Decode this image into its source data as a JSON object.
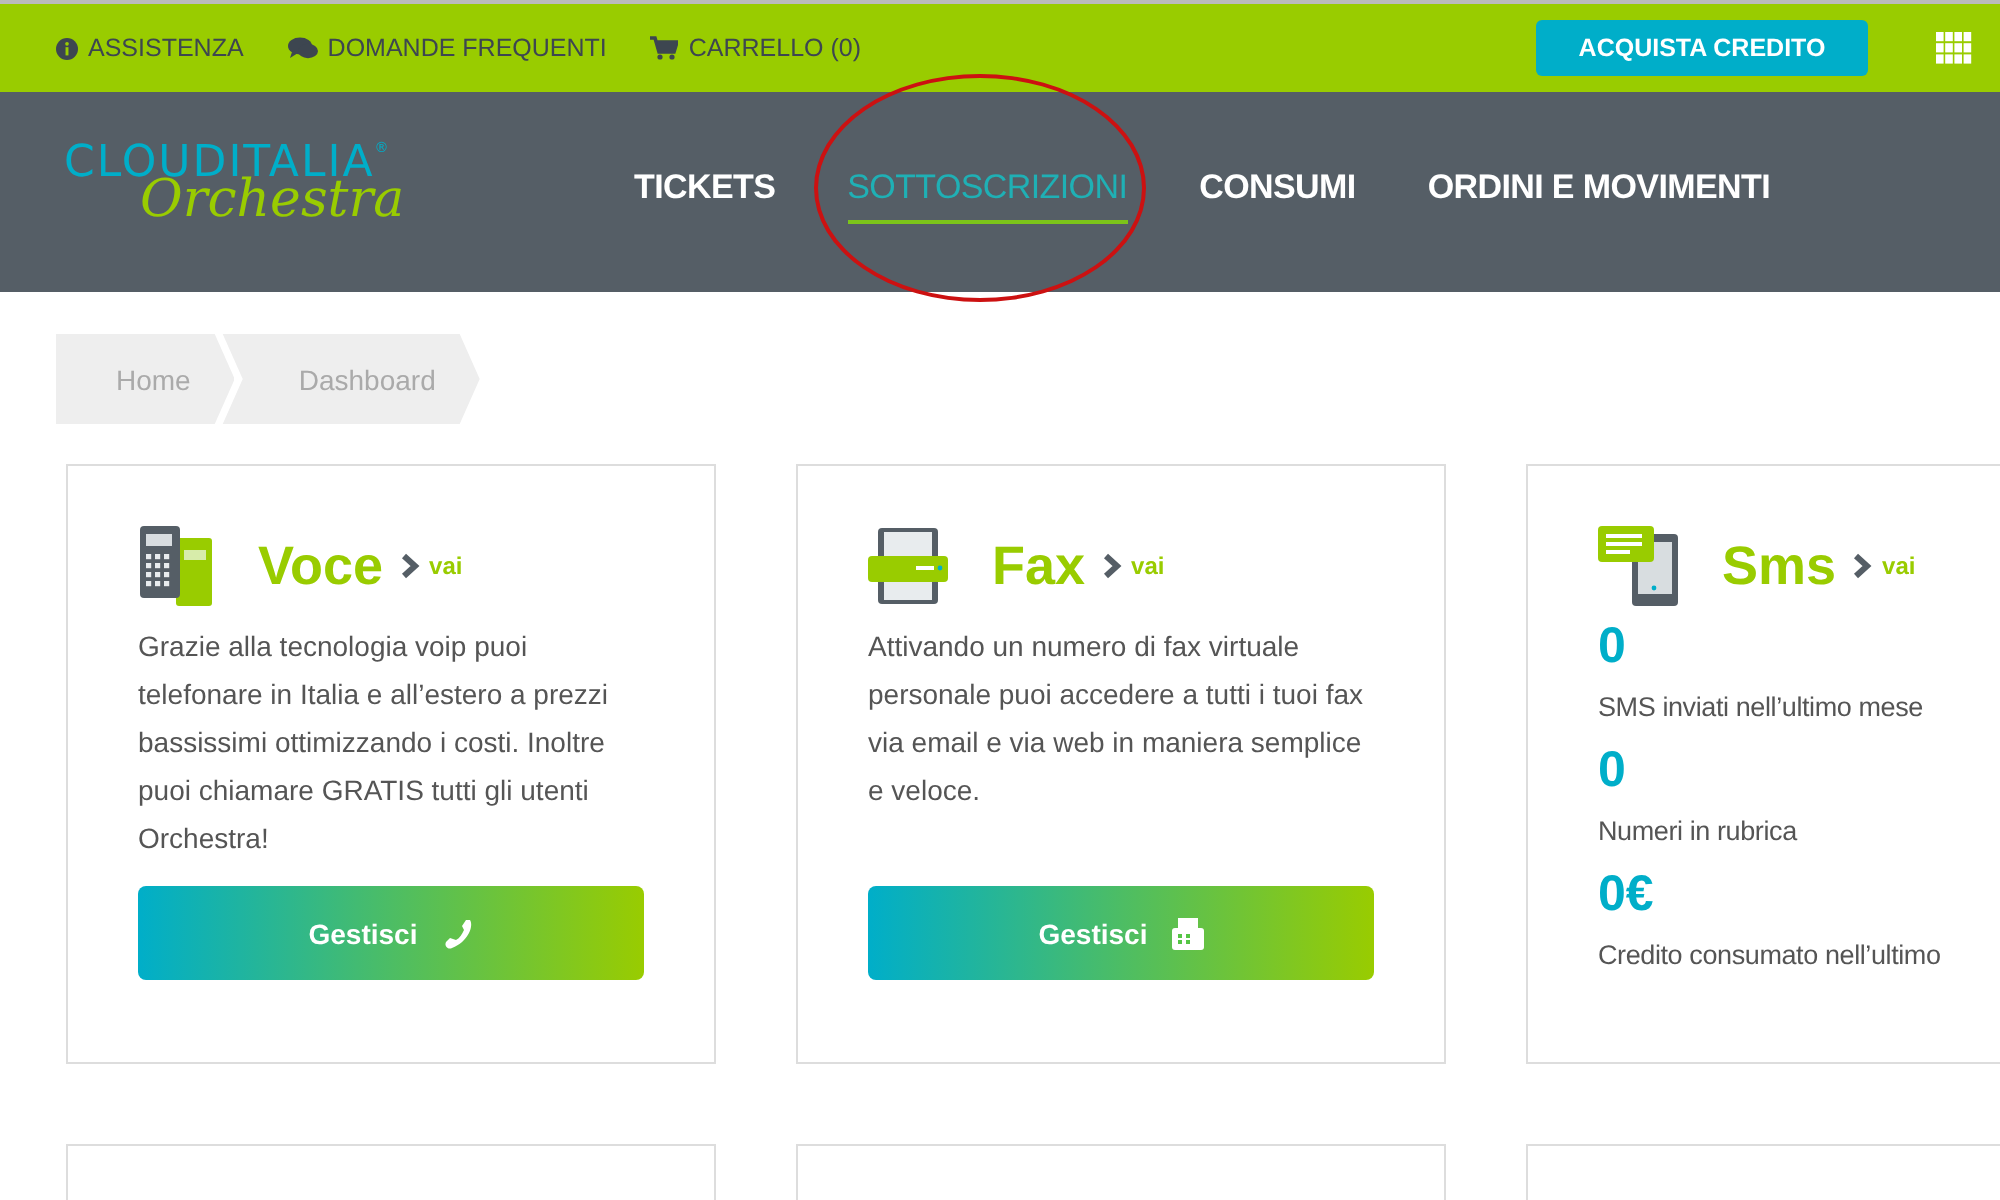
{
  "top_bar": {
    "links": [
      {
        "label": "ASSISTENZA"
      },
      {
        "label": "DOMANDE FREQUENTI"
      },
      {
        "label": "CARRELLO (0)"
      }
    ],
    "cta": "ACQUISTA CREDITO"
  },
  "logo": {
    "brand": "CLOUDITALIA",
    "sup": "®",
    "product": "Orchestra"
  },
  "nav": [
    {
      "label": "TICKETS",
      "selected": false
    },
    {
      "label": "SOTTOSCRIZIONI",
      "selected": true,
      "highlighted": true
    },
    {
      "label": "CONSUMI",
      "selected": false
    },
    {
      "label": "ORDINI E MOVIMENTI",
      "selected": false
    }
  ],
  "breadcrumb": [
    "Home",
    "Dashboard"
  ],
  "cards": [
    {
      "kind": "service",
      "title": "Voce",
      "link": "vai",
      "text": "Grazie alla tecnologia voip puoi telefonare in Italia e all’estero a prezzi bassissimi ottimizzando i costi. Inoltre puoi chiamare GRATIS tutti gli utenti Orchestra!",
      "button": "Gestisci"
    },
    {
      "kind": "service",
      "title": "Fax",
      "link": "vai",
      "text": "Attivando un numero di fax virtuale personale puoi accedere a tutti i tuoi fax via email e via web in maniera semplice e veloce.",
      "button": "Gestisci"
    },
    {
      "kind": "stats",
      "title": "Sms",
      "link": "vai",
      "stats": [
        {
          "value": "0",
          "label": "SMS inviati nell’ultimo mese"
        },
        {
          "value": "0",
          "label": "Numeri in rubrica"
        },
        {
          "value": "0€",
          "label": "Credito consumato nell’ultimo"
        }
      ]
    },
    {
      "kind": "empty"
    },
    {
      "kind": "empty"
    },
    {
      "kind": "empty"
    }
  ]
}
